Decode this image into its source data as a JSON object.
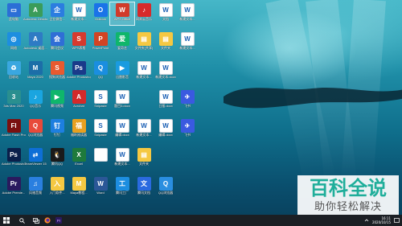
{
  "desktop": {
    "columns": [
      [
        "此电脑",
        "网络",
        "回收站",
        "3ds Max 2020",
        "Adobe Flash Prof...",
        "Adobe Photosho...",
        "Adobe Premie..."
      ],
      [
        "Autodesk Desktop...",
        "Autodesk 桌面...",
        "Maya 2020",
        "QQ音乐",
        "QQ浏览器",
        "TeamViewer 15",
        "风驰音频"
      ],
      [
        "企业微信...",
        "腾讯会议",
        "搜狗浏览器",
        "腾讯视频",
        "钉钉",
        "腾讯QQ",
        "入门软件..."
      ],
      [
        "新建文本...",
        "WPS表格",
        "Adobe Photoshop...",
        "Acrobat",
        "福昕阅读器",
        "Excel",
        "Maya教程..."
      ],
      [
        "Outlook",
        "PowerPoint",
        "QQ",
        "Snipaste",
        "Snipaste",
        "",
        "Word"
      ],
      [
        "WPS Office",
        "爱奇艺",
        "迅雷影音",
        "题目3.docx",
        "编辑.docx",
        "新建文本...",
        "腾讯工厂"
      ],
      [
        "网易云音乐",
        "文件夹(共享)",
        "新建文本...",
        "",
        "新建文本...",
        "文件夹",
        "腾讯文档"
      ],
      [
        "文档",
        "文件夹",
        "新建文本.docx",
        "日报.docx",
        "编辑.docx",
        "",
        "QQ浏览器"
      ],
      [
        "新建文本...",
        "新建文本...",
        "",
        "飞书",
        "飞书",
        "",
        ""
      ]
    ]
  },
  "taskbar": {
    "start_icon": "windows-logo",
    "search_icon": "search",
    "apps": [
      "task-view",
      "firefox",
      "premiere"
    ],
    "clock_time": "16:11",
    "clock_date": "2020/10/15"
  },
  "watermark": {
    "title": "百科全说",
    "subtitle": "助你轻松解决"
  }
}
